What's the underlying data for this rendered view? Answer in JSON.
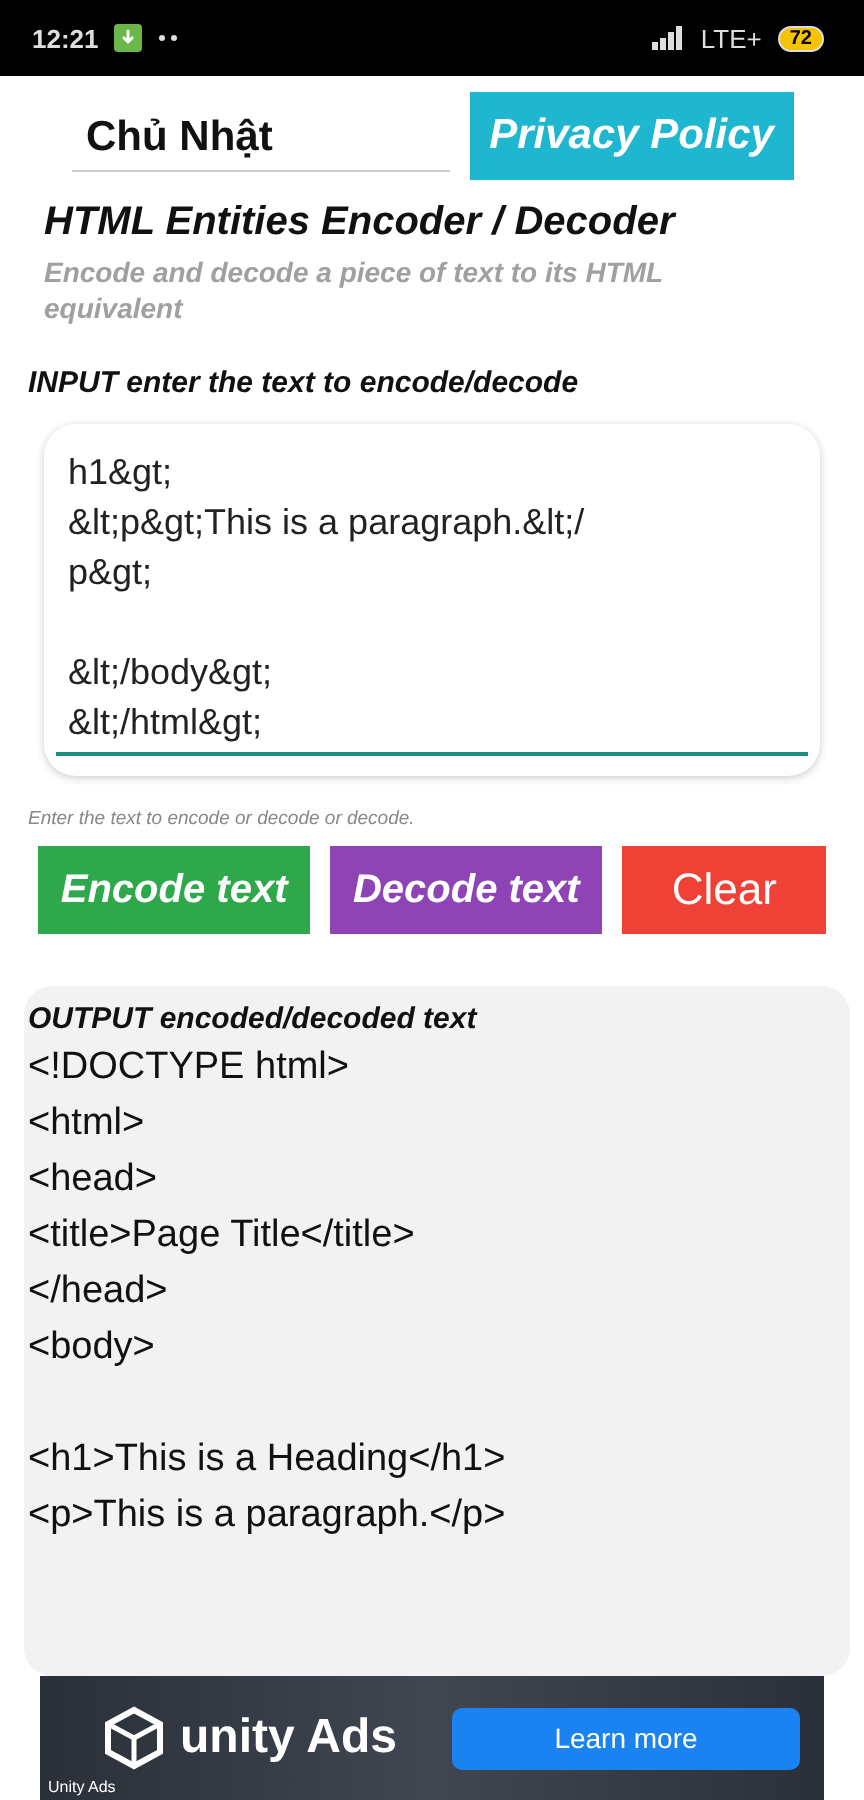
{
  "status_bar": {
    "time": "12:21",
    "network": "LTE+",
    "battery": "72"
  },
  "date_field": {
    "value": "Chủ Nhật"
  },
  "privacy_button": "Privacy Policy",
  "title": "HTML Entities Encoder / Decoder",
  "subtitle": "Encode and decode a piece of text to its HTML equivalent",
  "input": {
    "label_bold": "INPUT",
    "label": "enter the text to encode/decode",
    "value": "h1&gt;\n&lt;p&gt;This is a paragraph.&lt;/\np&gt;\n\n&lt;/body&gt;\n&lt;/html&gt;",
    "helper": "Enter the text to encode or decode or decode.",
    "focused": true
  },
  "buttons": [
    {
      "label": "Encode text",
      "kind": "encode",
      "color": "#2ea84a"
    },
    {
      "label": "Decode text",
      "kind": "decode",
      "color": "#8e44b5"
    },
    {
      "label": "Clear",
      "kind": "clear",
      "color": "#ef4136"
    }
  ],
  "output": {
    "label_bold": "OUTPUT",
    "label": "encoded/decoded text",
    "value": "<!DOCTYPE html>\n<html>\n<head>\n<title>Page Title</title>\n</head>\n<body>\n\n<h1>This is a Heading</h1>\n<p>This is a paragraph.</p>"
  },
  "ad": {
    "logo": "unity Ads",
    "button": "Learn more",
    "badge": "Unity Ads"
  }
}
